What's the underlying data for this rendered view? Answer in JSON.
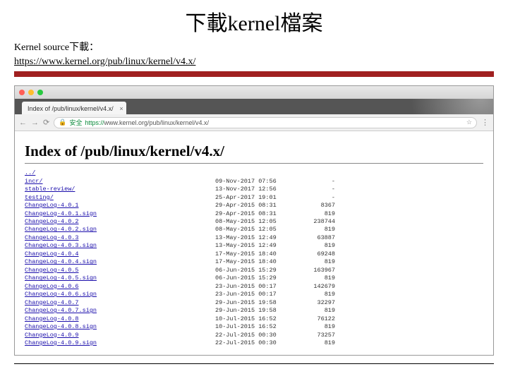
{
  "slide": {
    "title": "下載kernel檔案",
    "source_label": "Kernel source下載：",
    "source_url": "https://www.kernel.org/pub/linux/kernel/v4.x/"
  },
  "browser": {
    "tab_title": "Index of /pub/linux/kernel/v4.x/",
    "secure_label": "安全",
    "url_scheme": "https://",
    "url_rest": "www.kernel.org/pub/linux/kernel/v4.x/",
    "nav": {
      "back": "←",
      "forward": "→",
      "reload": "⟳",
      "lock": "🔒",
      "star": "☆",
      "close": "×",
      "menu": "⋮"
    }
  },
  "index": {
    "heading": "Index of /pub/linux/kernel/v4.x/",
    "rows": [
      {
        "name": "../",
        "date": "",
        "size": ""
      },
      {
        "name": "incr/",
        "date": "09-Nov-2017 07:56",
        "size": "-"
      },
      {
        "name": "stable-review/",
        "date": "13-Nov-2017 12:56",
        "size": "-"
      },
      {
        "name": "testing/",
        "date": "25-Apr-2017 19:01",
        "size": "-"
      },
      {
        "name": "ChangeLog-4.0.1",
        "date": "29-Apr-2015 08:31",
        "size": "8367"
      },
      {
        "name": "ChangeLog-4.0.1.sign",
        "date": "29-Apr-2015 08:31",
        "size": "819"
      },
      {
        "name": "ChangeLog-4.0.2",
        "date": "08-May-2015 12:05",
        "size": "238744"
      },
      {
        "name": "ChangeLog-4.0.2.sign",
        "date": "08-May-2015 12:05",
        "size": "819"
      },
      {
        "name": "ChangeLog-4.0.3",
        "date": "13-May-2015 12:49",
        "size": "63887"
      },
      {
        "name": "ChangeLog-4.0.3.sign",
        "date": "13-May-2015 12:49",
        "size": "819"
      },
      {
        "name": "ChangeLog-4.0.4",
        "date": "17-May-2015 18:40",
        "size": "69248"
      },
      {
        "name": "ChangeLog-4.0.4.sign",
        "date": "17-May-2015 18:40",
        "size": "819"
      },
      {
        "name": "ChangeLog-4.0.5",
        "date": "06-Jun-2015 15:29",
        "size": "163967"
      },
      {
        "name": "ChangeLog-4.0.5.sign",
        "date": "06-Jun-2015 15:29",
        "size": "819"
      },
      {
        "name": "ChangeLog-4.0.6",
        "date": "23-Jun-2015 00:17",
        "size": "142679"
      },
      {
        "name": "ChangeLog-4.0.6.sign",
        "date": "23-Jun-2015 00:17",
        "size": "819"
      },
      {
        "name": "ChangeLog-4.0.7",
        "date": "29-Jun-2015 19:58",
        "size": "32297"
      },
      {
        "name": "ChangeLog-4.0.7.sign",
        "date": "29-Jun-2015 19:58",
        "size": "819"
      },
      {
        "name": "ChangeLog-4.0.8",
        "date": "10-Jul-2015 16:52",
        "size": "76122"
      },
      {
        "name": "ChangeLog-4.0.8.sign",
        "date": "10-Jul-2015 16:52",
        "size": "819"
      },
      {
        "name": "ChangeLog-4.0.9",
        "date": "22-Jul-2015 00:30",
        "size": "73257"
      },
      {
        "name": "ChangeLog-4.0.9.sign",
        "date": "22-Jul-2015 00:30",
        "size": "819"
      }
    ]
  }
}
